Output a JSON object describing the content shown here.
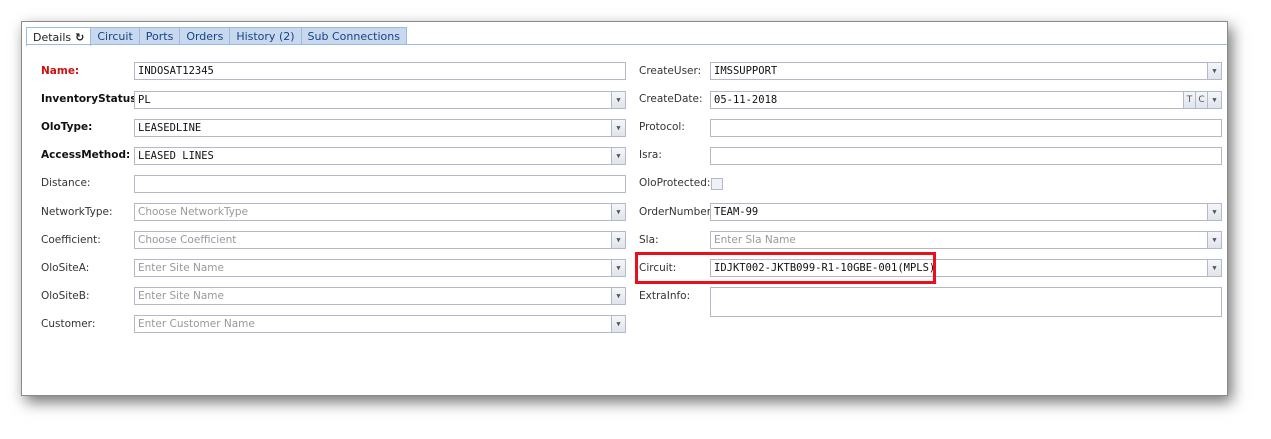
{
  "tabs": [
    {
      "label": "Details",
      "active": true
    },
    {
      "label": "Circuit",
      "active": false
    },
    {
      "label": "Ports",
      "active": false
    },
    {
      "label": "Orders",
      "active": false
    },
    {
      "label": "History (2)",
      "active": false
    },
    {
      "label": "Sub Connections",
      "active": false
    }
  ],
  "refresh_icon": "↻",
  "left": {
    "name": {
      "label": "Name:",
      "value": "INDOSAT12345"
    },
    "inventory_status": {
      "label": "InventoryStatus:",
      "value": "PL"
    },
    "olo_type": {
      "label": "OloType:",
      "value": "LEASEDLINE"
    },
    "access_method": {
      "label": "AccessMethod:",
      "value": "LEASED LINES"
    },
    "distance": {
      "label": "Distance:",
      "value": ""
    },
    "network_type": {
      "label": "NetworkType:",
      "placeholder": "Choose NetworkType"
    },
    "coefficient": {
      "label": "Coefficient:",
      "placeholder": "Choose Coefficient"
    },
    "olo_site_a": {
      "label": "OloSiteA:",
      "placeholder": "Enter Site Name"
    },
    "olo_site_b": {
      "label": "OloSiteB:",
      "placeholder": "Enter Site Name"
    },
    "customer": {
      "label": "Customer:",
      "placeholder": "Enter Customer Name"
    }
  },
  "right": {
    "create_user": {
      "label": "CreateUser:",
      "value": "IMSSUPPORT"
    },
    "create_date": {
      "label": "CreateDate:",
      "value": "05-11-2018",
      "btn_t": "T",
      "btn_c": "C"
    },
    "protocol": {
      "label": "Protocol:",
      "value": ""
    },
    "isra": {
      "label": "Isra:",
      "value": ""
    },
    "olo_protected": {
      "label": "OloProtected:",
      "checked": false
    },
    "order_number": {
      "label": "OrderNumber:",
      "value": "TEAM-99"
    },
    "sla": {
      "label": "Sla:",
      "placeholder": "Enter Sla Name"
    },
    "circuit": {
      "label": "Circuit:",
      "value": "IDJKT002-JKTB099-R1-10GBE-001(MPLS)"
    },
    "extra_info": {
      "label": "ExtraInfo:",
      "value": ""
    }
  },
  "colors": {
    "required_label": "#d01010",
    "highlight": "#e8101a",
    "tab_bg": "#c8d9ee"
  }
}
